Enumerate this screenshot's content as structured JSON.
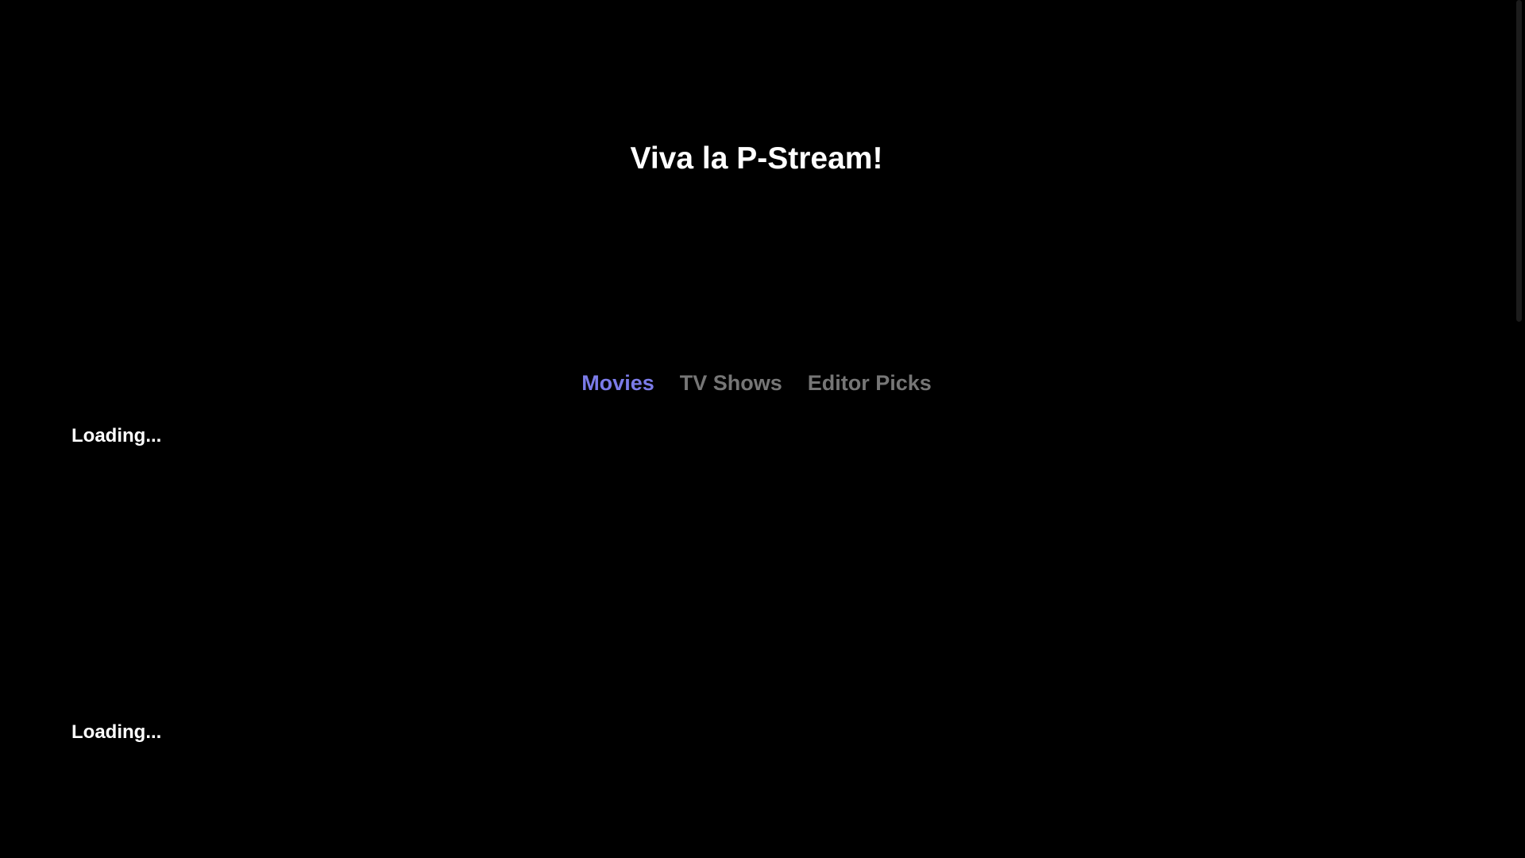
{
  "header": {
    "title": "Viva la P-Stream!"
  },
  "tabs": [
    {
      "label": "Movies",
      "active": true
    },
    {
      "label": "TV Shows",
      "active": false
    },
    {
      "label": "Editor Picks",
      "active": false
    }
  ],
  "sections": [
    {
      "heading": "Loading..."
    },
    {
      "heading": "Loading..."
    }
  ],
  "colors": {
    "background": "#000000",
    "active_tab": "#7b7be8",
    "inactive_tab": "#767676",
    "text": "#ffffff"
  }
}
